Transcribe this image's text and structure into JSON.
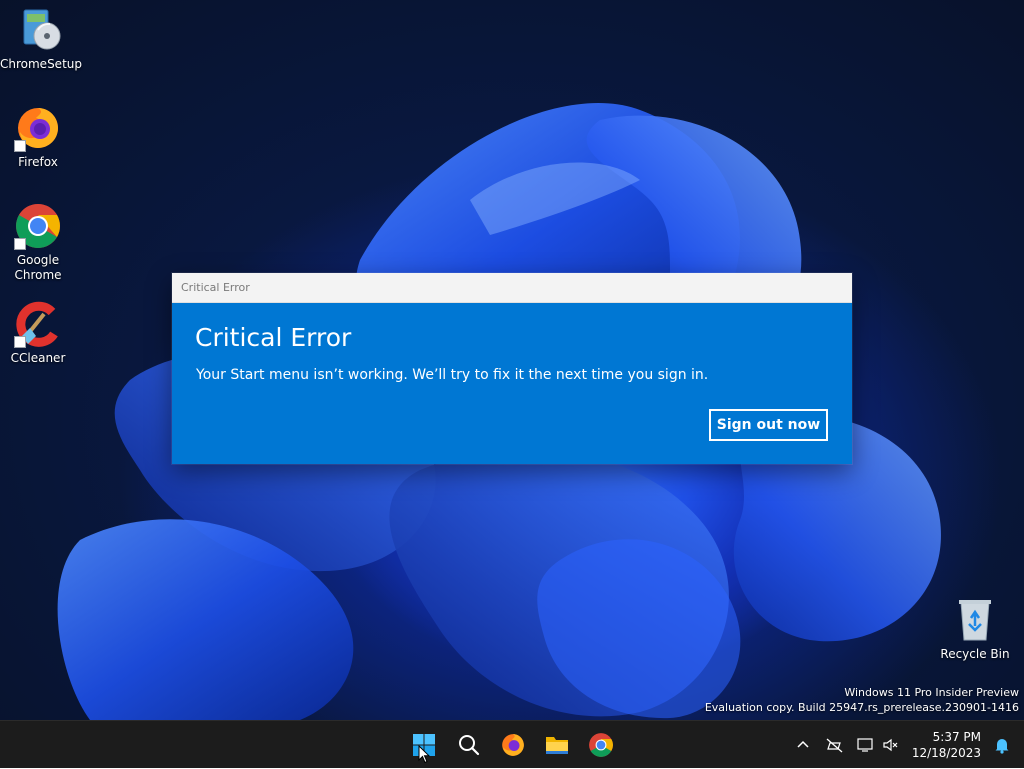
{
  "desktop": {
    "icons": [
      {
        "label": "ChromeSetup",
        "icon": "installer-cd-icon"
      },
      {
        "label": "Firefox",
        "icon": "firefox-icon"
      },
      {
        "label": "Google Chrome",
        "icon": "chrome-icon"
      },
      {
        "label": "CCleaner",
        "icon": "ccleaner-icon"
      }
    ],
    "recycle_bin": {
      "label": "Recycle Bin",
      "icon": "recycle-bin-icon"
    }
  },
  "dialog": {
    "window_title": "Critical Error",
    "heading": "Critical Error",
    "message": "Your Start menu isn’t working. We’ll try to fix it the next time you sign in.",
    "button_label": "Sign out now",
    "accent_color": "#0077d3"
  },
  "watermark": {
    "line1": "Windows 11 Pro Insider Preview",
    "line2": "Evaluation copy. Build 25947.rs_prerelease.230901-1416"
  },
  "taskbar": {
    "pinned": [
      {
        "name": "start-button",
        "icon": "windows-logo-icon"
      },
      {
        "name": "search-button",
        "icon": "search-icon"
      },
      {
        "name": "firefox-taskbar-button",
        "icon": "firefox-icon"
      },
      {
        "name": "file-explorer-taskbar-button",
        "icon": "folder-icon"
      },
      {
        "name": "chrome-taskbar-button",
        "icon": "chrome-icon"
      }
    ],
    "tray": {
      "icons": [
        "chevron-up-icon",
        "network-disconnected-icon",
        "display-icon",
        "volume-muted-icon",
        "notification-bell-icon"
      ],
      "time": "5:37 PM",
      "date": "12/18/2023"
    }
  }
}
